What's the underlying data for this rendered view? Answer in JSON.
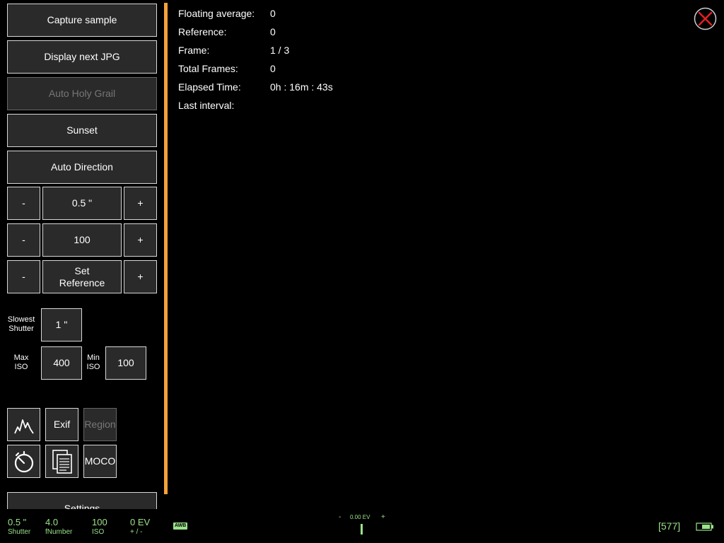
{
  "buttons": {
    "capture_sample": "Capture sample",
    "display_next_jpg": "Display next JPG",
    "auto_holy_grail": "Auto Holy Grail",
    "sunset": "Sunset",
    "auto_direction": "Auto Direction",
    "minus": "-",
    "plus": "+",
    "shutter_value": "0.5 \"",
    "iso_value": "100",
    "set_reference": "Set Reference",
    "exif": "Exif",
    "region": "Region",
    "moco": "MOCO",
    "settings": "Settings"
  },
  "limits": {
    "slowest_shutter_label": "Slowest Shutter",
    "slowest_shutter_value": "1 \"",
    "max_iso_label": "Max ISO",
    "max_iso_value": "400",
    "min_iso_label": "Min ISO",
    "min_iso_value": "100"
  },
  "info": {
    "floating_average_label": "Floating average:",
    "floating_average_value": "0",
    "reference_label": "Reference:",
    "reference_value": "0",
    "frame_label": "Frame:",
    "frame_value": "1 / 3",
    "total_frames_label": "Total Frames:",
    "total_frames_value": "0",
    "elapsed_time_label": "Elapsed Time:",
    "elapsed_time_value": "0h : 16m : 43s",
    "last_interval_label": "Last interval:",
    "last_interval_value": ""
  },
  "status_bar": {
    "shutter_value": "0.5 \"",
    "shutter_label": "Shutter",
    "fnumber_value": "4.0",
    "fnumber_label": "fNumber",
    "iso_value": "100",
    "iso_label": "ISO",
    "ev_value": "0 EV",
    "ev_label": "+ / -",
    "awb_badge": "AWB",
    "meter_minus": "-",
    "meter_value": "0.00 EV",
    "meter_plus": "+",
    "shots_remaining": "[577]"
  },
  "colors": {
    "accent": "#f7a23b",
    "status_green": "#9be38a",
    "close_red": "#e02020"
  },
  "icons": {
    "histogram": "histogram-icon",
    "timer": "timer-icon",
    "copy_document": "copy-document-icon",
    "close": "close-icon",
    "battery": "battery-icon"
  }
}
